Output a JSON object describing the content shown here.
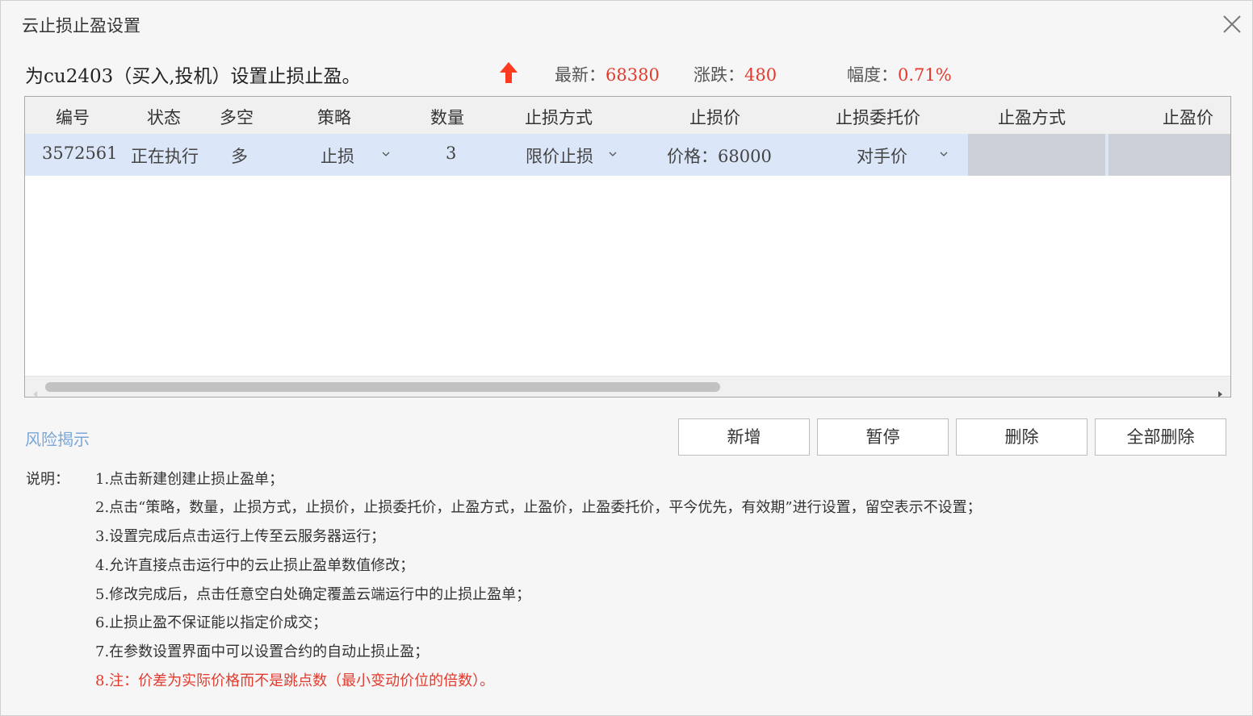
{
  "window": {
    "title": "云止损止盈设置"
  },
  "info": {
    "contract_line": "为cu2403（买入,投机）设置止损止盈。",
    "latest_label": "最新：",
    "latest_value": "68380",
    "change_label": "涨跌：",
    "change_value": "480",
    "range_label": "幅度：",
    "range_value": "0.71%",
    "trend_icon": "up-arrow-icon",
    "trend_color": "#ff3b1f"
  },
  "table": {
    "columns": [
      "编号",
      "状态",
      "多空",
      "策略",
      "数量",
      "止损方式",
      "止损价",
      "止损委托价",
      "止盈方式",
      "止盈价"
    ],
    "rows": [
      {
        "id": "3572561",
        "status": "正在执行",
        "direction": "多",
        "strategy": "止损",
        "quantity": "3",
        "sl_method": "限价止损",
        "sl_price": "价格：68000",
        "sl_order_price": "对手价",
        "tp_method": "",
        "tp_price": ""
      }
    ]
  },
  "actions": {
    "risk_link": "风险揭示",
    "add": "新增",
    "pause": "暂停",
    "delete": "删除",
    "delete_all": "全部删除"
  },
  "notes": {
    "label": "说明：",
    "items": [
      "1.点击新建创建止损止盈单；",
      "2.点击“策略，数量，止损方式，止损价，止损委托价，止盈方式，止盈价，止盈委托价，平今优先，有效期”进行设置，留空表示不设置；",
      "3.设置完成后点击运行上传至云服务器运行；",
      "4.允许直接点击运行中的云止损止盈单数值修改；",
      "5.修改完成后，点击任意空白处确定覆盖云端运行中的止损止盈单；",
      "6.止损止盈不保证能以指定价成交；",
      "7.在参数设置界面中可以设置合约的自动止损止盈；",
      "8.注：价差为实际价格而不是跳点数（最小变动价位的倍数）。"
    ]
  },
  "colors": {
    "accent_red": "#e23b2e",
    "row_selected": "#dbe6f8",
    "link_blue": "#7aa7d6"
  }
}
